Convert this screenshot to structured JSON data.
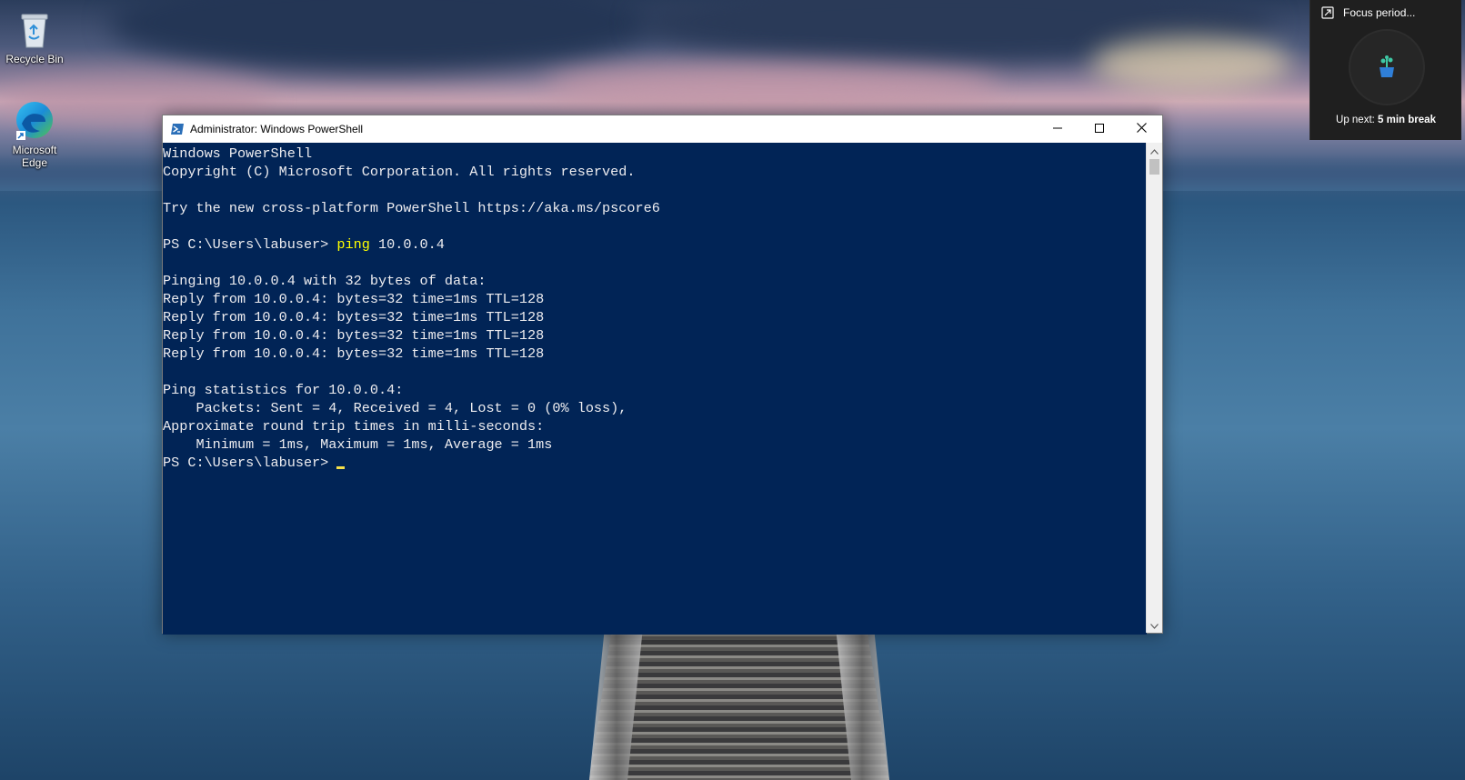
{
  "desktop": {
    "icons": [
      {
        "label": "Recycle Bin",
        "icon": "recycle-bin-icon"
      },
      {
        "label": "Microsoft Edge",
        "icon": "edge-icon"
      }
    ]
  },
  "focus_widget": {
    "title": "Focus period...",
    "next_prefix": "Up next: ",
    "next_value": "5 min break",
    "icon": "plant-icon"
  },
  "window": {
    "title": "Administrator: Windows PowerShell",
    "icon": "powershell-icon",
    "controls": {
      "minimize": "minimize-icon",
      "maximize": "maximize-icon",
      "close": "close-icon"
    },
    "colors": {
      "console_bg": "#012456",
      "console_fg": "#eeedf0",
      "command": "#ffff00"
    }
  },
  "console": {
    "lines": [
      "Windows PowerShell",
      "Copyright (C) Microsoft Corporation. All rights reserved.",
      "",
      "Try the new cross-platform PowerShell https://aka.ms/pscore6",
      "",
      {
        "prompt": "PS C:\\Users\\labuser> ",
        "cmd": "ping",
        "args": " 10.0.0.4"
      },
      "",
      "Pinging 10.0.0.4 with 32 bytes of data:",
      "Reply from 10.0.0.4: bytes=32 time=1ms TTL=128",
      "Reply from 10.0.0.4: bytes=32 time=1ms TTL=128",
      "Reply from 10.0.0.4: bytes=32 time=1ms TTL=128",
      "Reply from 10.0.0.4: bytes=32 time=1ms TTL=128",
      "",
      "Ping statistics for 10.0.0.4:",
      "    Packets: Sent = 4, Received = 4, Lost = 0 (0% loss),",
      "Approximate round trip times in milli-seconds:",
      "    Minimum = 1ms, Maximum = 1ms, Average = 1ms",
      {
        "prompt": "PS C:\\Users\\labuser> ",
        "cursor": true
      }
    ]
  }
}
